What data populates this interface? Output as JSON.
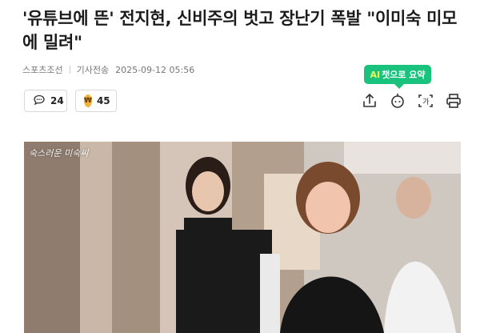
{
  "article": {
    "headline": "'유튜브에 뜬' 전지현, 신비주의 벗고 장난기 폭발 \"이미숙 미모에 밀려\"",
    "source": "스포츠조선",
    "sent_label": "기사전송",
    "datetime": "2025-09-12 05:56"
  },
  "ai_summary": {
    "ai": "AI",
    "label": "챗으로 요약"
  },
  "reactions": {
    "comments_count": "24",
    "likes_count": "45"
  },
  "toolbar": {
    "icons": [
      "share-icon",
      "chatbot-icon",
      "font-size-icon",
      "print-icon"
    ]
  },
  "photo": {
    "watermark": "숙스러운 미숙씨"
  },
  "colors": {
    "accent_green": "#19c37d",
    "coin_gold": "#f0b43a"
  }
}
